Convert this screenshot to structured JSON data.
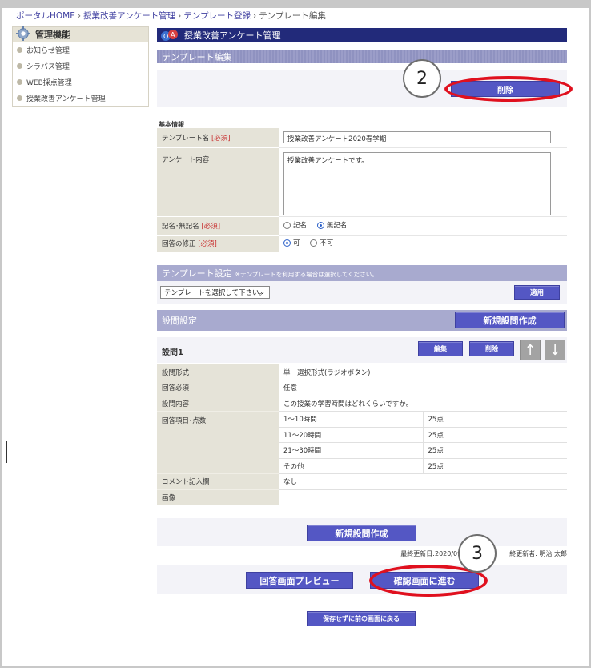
{
  "breadcrumb": {
    "items": [
      "ポータルHOME",
      "授業改善アンケート管理",
      "テンプレート登録",
      "テンプレート編集"
    ],
    "separator": "›"
  },
  "sidebar": {
    "title": "管理機能",
    "items": [
      {
        "label": "お知らせ管理"
      },
      {
        "label": "シラバス管理"
      },
      {
        "label": "WEB採点管理"
      },
      {
        "label": "授業改善アンケート管理"
      }
    ]
  },
  "main": {
    "title": "授業改善アンケート管理",
    "section_title": "テンプレート編集",
    "delete_label": "削除",
    "callout_2": "2",
    "callout_3": "3",
    "basic_info_label": "基本情報",
    "fields": {
      "template_name_label": "テンプレート名",
      "required": "[必須]",
      "template_name_value": "授業改善アンケート2020春学期",
      "survey_content_label": "アンケート内容",
      "survey_content_value": "授業改善アンケートです。",
      "named_label": "記名･無記名",
      "named_options": [
        "記名",
        "無記名"
      ],
      "named_selected": "無記名",
      "edit_answer_label": "回答の修正",
      "edit_answer_options": [
        "可",
        "不可"
      ],
      "edit_answer_selected": "可"
    },
    "template_settings": {
      "title": "テンプレート設定",
      "note": "※テンプレートを利用する場合は選択してください。",
      "select_value": "テンプレートを選択して下さい。",
      "apply_label": "適用"
    },
    "question_settings": {
      "title": "設問設定",
      "new_question_label": "新規設問作成"
    },
    "question1": {
      "title": "設問1",
      "edit_label": "編集",
      "delete_label": "削除",
      "up_label": "↑",
      "down_label": "↓",
      "rows": {
        "format_label": "設問形式",
        "format_value": "単一選択形式(ラジオボタン)",
        "required_label": "回答必須",
        "required_value": "任意",
        "content_label": "設問内容",
        "content_value": "この授業の学習時間はどれくらいですか。",
        "items_label": "回答項目･点数",
        "items": [
          {
            "label": "1～10時間",
            "score": "25点"
          },
          {
            "label": "11～20時間",
            "score": "25点"
          },
          {
            "label": "21～30時間",
            "score": "25点"
          },
          {
            "label": "その他",
            "score": "25点"
          }
        ],
        "comment_label": "コメント記入欄",
        "comment_value": "なし",
        "image_label": "画像",
        "image_value": ""
      }
    },
    "new_question_bottom_label": "新規設問作成",
    "last_updated": "最終更新日:2020/09",
    "last_updater": "終更新者: 明治 太郎",
    "preview_label": "回答画面プレビュー",
    "confirm_label": "確認画面に進む",
    "back_label": "保存せずに前の画面に戻る"
  },
  "colors": {
    "title_bar": "#222a7a",
    "section": "#a8aacf",
    "button": "#5457c4",
    "callout_oval": "#e0101e",
    "label_bg": "#e5e3d8",
    "required": "#c83030"
  }
}
